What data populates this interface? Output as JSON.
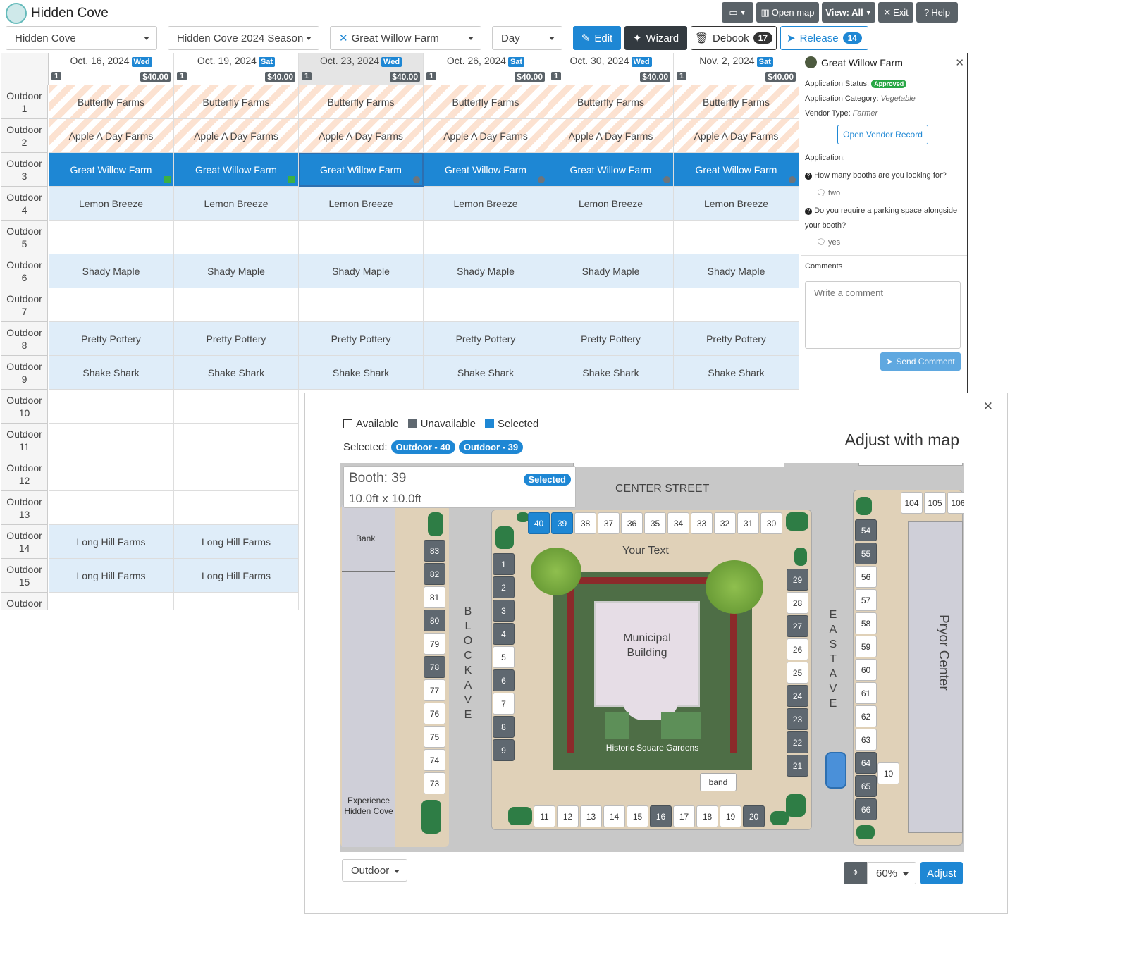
{
  "app": {
    "title": "Hidden Cove"
  },
  "toolbar": {
    "open_map": "Open map",
    "view_all": "View: All",
    "exit": "Exit",
    "help": "Help"
  },
  "filters": {
    "market": "Hidden Cove",
    "season": "Hidden Cove 2024 Season",
    "vendor": "Great Willow Farm",
    "view": "Day"
  },
  "actions": {
    "edit": "Edit",
    "wizard": "Wizard",
    "debook": "Debook",
    "debook_count": "17",
    "release": "Release",
    "release_count": "14"
  },
  "dates": [
    {
      "date": "Oct. 16, 2024",
      "dow": "Wed",
      "count": "1",
      "price": "$40.00"
    },
    {
      "date": "Oct. 19, 2024",
      "dow": "Sat",
      "count": "1",
      "price": "$40.00"
    },
    {
      "date": "Oct. 23, 2024",
      "dow": "Wed",
      "count": "1",
      "price": "$40.00"
    },
    {
      "date": "Oct. 26, 2024",
      "dow": "Sat",
      "count": "1",
      "price": "$40.00"
    },
    {
      "date": "Oct. 30, 2024",
      "dow": "Wed",
      "count": "1",
      "price": "$40.00"
    },
    {
      "date": "Nov. 2, 2024",
      "dow": "Sat",
      "count": "1",
      "price": "$40.00"
    }
  ],
  "rows": [
    {
      "label": [
        "Outdoor",
        "1"
      ],
      "vendor": "Butterfly Farms",
      "style": "stripe",
      "cols": 6
    },
    {
      "label": [
        "Outdoor",
        "2"
      ],
      "vendor": "Apple A Day Farms",
      "style": "stripe",
      "cols": 6
    },
    {
      "label": [
        "Outdoor",
        "3"
      ],
      "vendor": "Great Willow Farm",
      "style": "sel3",
      "cols": 6
    },
    {
      "label": [
        "Outdoor",
        "4"
      ],
      "vendor": "Lemon Breeze",
      "style": "light",
      "cols": 6
    },
    {
      "label": [
        "Outdoor",
        "5"
      ],
      "vendor": "",
      "style": "",
      "cols": 6
    },
    {
      "label": [
        "Outdoor",
        "6"
      ],
      "vendor": "Shady Maple",
      "style": "light",
      "cols": 6
    },
    {
      "label": [
        "Outdoor",
        "7"
      ],
      "vendor": "",
      "style": "",
      "cols": 6
    },
    {
      "label": [
        "Outdoor",
        "8"
      ],
      "vendor": "Pretty Pottery",
      "style": "light",
      "cols": 6
    },
    {
      "label": [
        "Outdoor",
        "9"
      ],
      "vendor": "Shake Shark",
      "style": "light",
      "cols": 6
    },
    {
      "label": [
        "Outdoor",
        "10"
      ],
      "vendor": "",
      "style": "",
      "cols": 2
    },
    {
      "label": [
        "Outdoor",
        "11"
      ],
      "vendor": "",
      "style": "",
      "cols": 2
    },
    {
      "label": [
        "Outdoor",
        "12"
      ],
      "vendor": "",
      "style": "",
      "cols": 2
    },
    {
      "label": [
        "Outdoor",
        "13"
      ],
      "vendor": "",
      "style": "",
      "cols": 2
    },
    {
      "label": [
        "Outdoor",
        "14"
      ],
      "vendor": "Long Hill Farms",
      "style": "light",
      "cols": 2
    },
    {
      "label": [
        "Outdoor",
        "15"
      ],
      "vendor": "Long Hill Farms",
      "style": "light",
      "cols": 2
    },
    {
      "label": [
        "Outdoor",
        ""
      ],
      "vendor": "",
      "style": "",
      "cols": 2
    }
  ],
  "vendor_panel": {
    "name": "Great Willow Farm",
    "status_label": "Application Status:",
    "status": "Approved",
    "category_label": "Application Category:",
    "category": "Vegetable",
    "type_label": "Vendor Type:",
    "type": "Farmer",
    "open_record": "Open Vendor Record",
    "application_label": "Application:",
    "q1": "How many booths are you looking for?",
    "a1": "two",
    "q2a": "Do you require a parking space alongside",
    "q2b": "your booth?",
    "a2": "yes",
    "comments_label": "Comments",
    "comment_placeholder": "Write a comment",
    "send": "Send Comment"
  },
  "map_modal": {
    "legend_available": "Available",
    "legend_unavailable": "Unavailable",
    "legend_selected": "Selected",
    "selected_label": "Selected:",
    "chip1": "Outdoor - 40",
    "chip2": "Outdoor - 39",
    "title": "Adjust with map",
    "tooltip_booth": "Booth: 39",
    "tooltip_size": "10.0ft x 10.0ft",
    "tooltip_badge": "Selected",
    "street_center": "CENTER STREET",
    "street_block": "BLOCK AVE",
    "street_east": "EAST AVE",
    "bank": "Bank",
    "experience": "Experience Hidden Cove",
    "your_text": "Your Text",
    "municipal": "Municipal Building",
    "gardens": "Historic Square Gardens",
    "band": "band",
    "pryor": "Pryor Center",
    "area_select": "Outdoor",
    "zoom": "60%",
    "adjust": "Adjust"
  },
  "colors": {
    "primary": "#1e87d4",
    "dark": "#333a40",
    "unavailable": "#5f6870",
    "stripe": "#fce2d1",
    "light_row": "#dfedf9"
  }
}
